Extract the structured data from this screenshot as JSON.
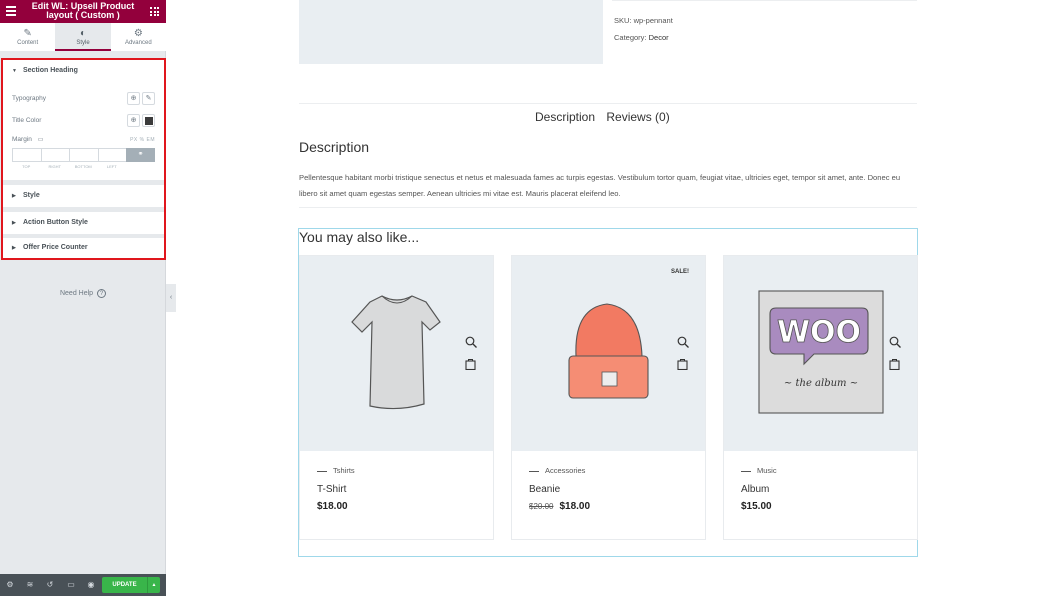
{
  "panel": {
    "title": "Edit WL: Upsell Product layout ( Custom )",
    "tabs": [
      {
        "label": "Content",
        "icon": "pencil-icon"
      },
      {
        "label": "Style",
        "icon": "half-circle-icon"
      },
      {
        "label": "Advanced",
        "icon": "gear-icon"
      }
    ],
    "active_tab": "Style",
    "sections": {
      "heading": "Section Heading",
      "typography_label": "Typography",
      "title_color_label": "Title Color",
      "margin_label": "Margin",
      "units": "PX  %  EM",
      "dim_labels": [
        "TOP",
        "RIGHT",
        "BOTTOM",
        "LEFT"
      ],
      "style": "Style",
      "action_button_style": "Action Button Style",
      "offer_price_counter": "Offer Price Counter"
    },
    "title_color": "#3b3b3b",
    "need_help": "Need Help",
    "footer": {
      "update_label": "UPDATE",
      "accent": "#39b54a"
    }
  },
  "brand_color": "#93003c",
  "product": {
    "sku": "SKU: wp-pennant",
    "category_label": "Category:",
    "category_value": "Decor",
    "tabs": [
      "Description",
      "Reviews (0)"
    ],
    "description_title": "Description",
    "description_text": "Pellentesque habitant morbi tristique senectus et netus et malesuada fames ac turpis egestas. Vestibulum tortor quam, feugiat vitae, ultricies eget, tempor sit amet, ante. Donec eu libero sit amet quam egestas semper. Aenean ultricies mi vitae est. Mauris placerat eleifend leo."
  },
  "upsell": {
    "title": "You may also like...",
    "cards": [
      {
        "category": "Tshirts",
        "name": "T-Shirt",
        "price": "$18.00",
        "old_price": "",
        "sale": ""
      },
      {
        "category": "Accessories",
        "name": "Beanie",
        "price": "$18.00",
        "old_price": "$20.00",
        "sale": "SALE!"
      },
      {
        "category": "Music",
        "name": "Album",
        "price": "$15.00",
        "old_price": "",
        "sale": ""
      }
    ]
  }
}
